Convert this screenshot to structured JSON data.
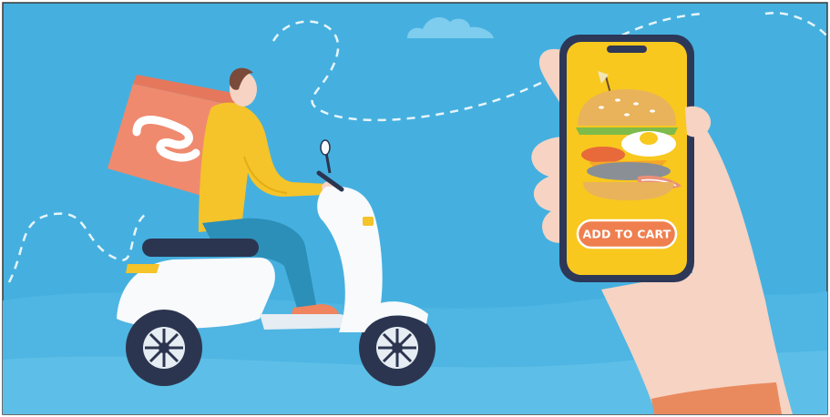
{
  "phone": {
    "cta_label": "ADD TO CART"
  },
  "colors": {
    "sky": "#45B0DF",
    "sky_light": "#6FC4EA",
    "ground": "#56B8E3",
    "box": "#EF8A6E",
    "jacket": "#F5C32A",
    "pants": "#2C8FB8",
    "scooter": "#F8FAFC",
    "tire": "#2C3550",
    "phone_body": "#2D3758",
    "phone_screen": "#F8C81E",
    "button": "#EF7F4E",
    "skin": "#F6D3C3",
    "sleeve": "#E98A5E"
  },
  "icons": [
    "delivery-box-logo-icon",
    "burger-icon",
    "cloud-icon"
  ]
}
